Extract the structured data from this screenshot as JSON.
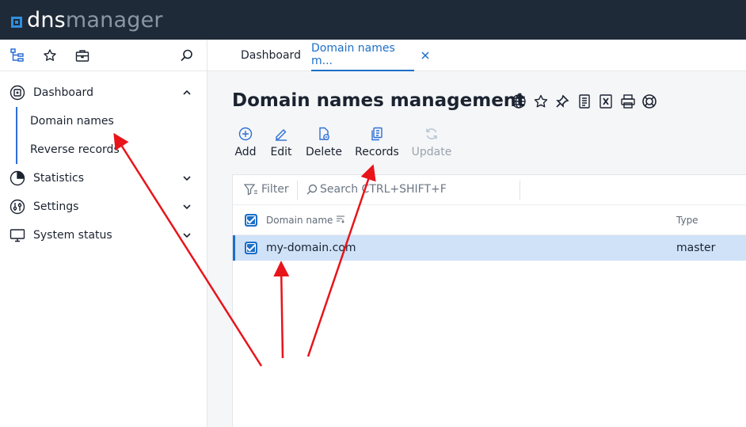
{
  "app": {
    "logo_part1": "dns",
    "logo_part2": "manager"
  },
  "sidebar": {
    "tools": [
      "tree-icon",
      "star-icon",
      "briefcase-icon",
      "search-icon"
    ],
    "items": [
      {
        "label": "Dashboard",
        "icon": "dashboard-icon",
        "expanded": true
      },
      {
        "label": "Domain names"
      },
      {
        "label": "Reverse records"
      },
      {
        "label": "Statistics",
        "icon": "pie-chart-icon",
        "expanded": false
      },
      {
        "label": "Settings",
        "icon": "settings-sliders-icon",
        "expanded": false
      },
      {
        "label": "System status",
        "icon": "monitor-icon",
        "expanded": false
      }
    ]
  },
  "tabs": [
    {
      "label": "Dashboard",
      "active": false
    },
    {
      "label": "Domain names m...",
      "active": true
    }
  ],
  "page": {
    "title": "Domain names management",
    "title_icons": [
      "globe-icon",
      "star-icon",
      "pin-icon",
      "document-icon",
      "excel-icon",
      "print-icon",
      "help-icon"
    ]
  },
  "actions": [
    {
      "label": "Add",
      "icon": "plus-icon",
      "enabled": true
    },
    {
      "label": "Edit",
      "icon": "pencil-icon",
      "enabled": true
    },
    {
      "label": "Delete",
      "icon": "delete-icon",
      "enabled": true
    },
    {
      "label": "Records",
      "icon": "records-icon",
      "enabled": true
    },
    {
      "label": "Update",
      "icon": "refresh-icon",
      "enabled": false
    }
  ],
  "filterbar": {
    "filter_label": "Filter",
    "search_label": "Search CTRL+SHIFT+F"
  },
  "table": {
    "columns": [
      "Domain name",
      "Type"
    ],
    "rows": [
      {
        "domain": "my-domain.com",
        "type": "master",
        "selected": true
      }
    ]
  },
  "colors": {
    "accent": "#1d6fc8",
    "topbar": "#1f2a38",
    "selected_row": "#cfe2f8",
    "annotation": "#e8141a"
  }
}
